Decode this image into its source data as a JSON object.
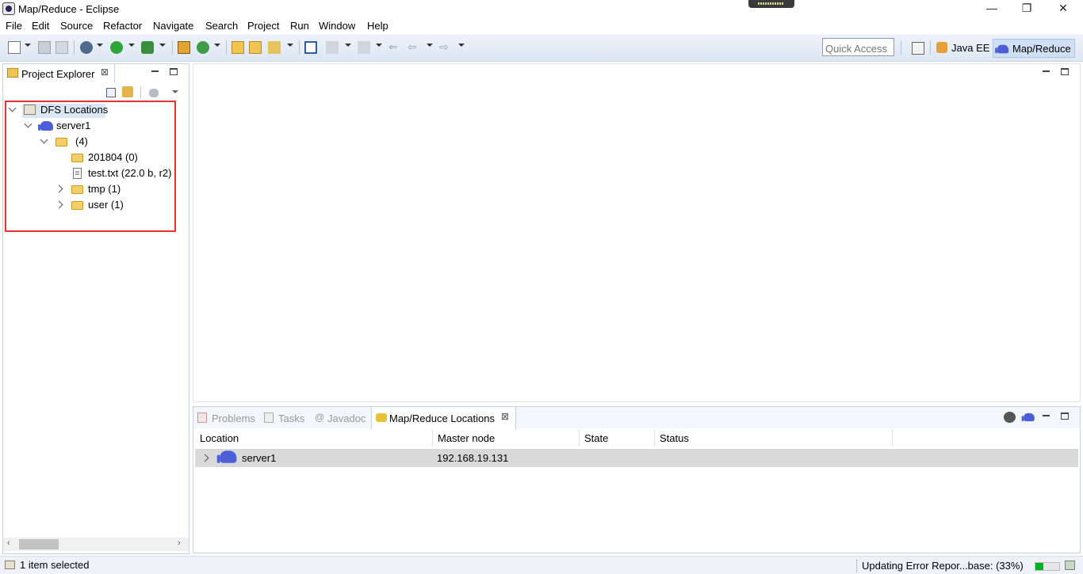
{
  "window": {
    "title": "Map/Reduce - Eclipse",
    "minimize_glyph": "—",
    "restore_glyph": "❐",
    "close_glyph": "✕"
  },
  "menu": [
    "File",
    "Edit",
    "Source",
    "Refactor",
    "Navigate",
    "Search",
    "Project",
    "Run",
    "Window",
    "Help"
  ],
  "toolbar": {
    "quick_access_placeholder": "Quick Access",
    "perspectives": [
      {
        "label": "Java EE",
        "icon": "java-ee-perspective-icon",
        "active": false
      },
      {
        "label": "Map/Reduce",
        "icon": "mapreduce-perspective-icon",
        "active": true
      }
    ]
  },
  "project_explorer": {
    "tab_label": "Project Explorer",
    "tree": {
      "root": "DFS Locations",
      "server": "server1",
      "dir": "(4)",
      "children": [
        "201804 (0)",
        "test.txt (22.0 b, r2)",
        "tmp (1)",
        "user (1)"
      ]
    }
  },
  "bottom_panel": {
    "tabs": [
      {
        "label": "Problems",
        "active": false
      },
      {
        "label": "Tasks",
        "active": false
      },
      {
        "label": "Javadoc",
        "active": false
      },
      {
        "label": "Map/Reduce Locations",
        "active": true
      }
    ],
    "columns": [
      "Location",
      "Master node",
      "State",
      "Status"
    ],
    "rows": [
      {
        "location": "server1",
        "master_node": "192.168.19.131",
        "state": "",
        "status": ""
      }
    ]
  },
  "status_bar": {
    "selection": "1 item selected",
    "progress_text": "Updating Error Repor...base: (33%)",
    "progress": 0.33,
    "progress_color": "#06b025"
  }
}
